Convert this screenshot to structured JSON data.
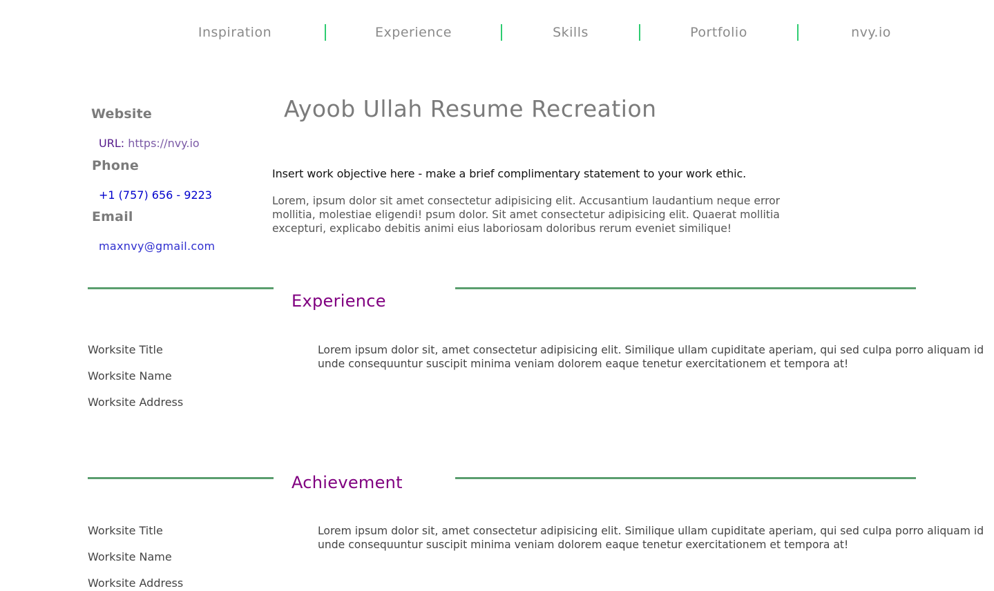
{
  "nav": {
    "items": [
      {
        "label": "Inspiration"
      },
      {
        "label": "Experience"
      },
      {
        "label": "Skills"
      },
      {
        "label": "Portfolio"
      },
      {
        "label": "nvy.io"
      }
    ]
  },
  "sidebar": {
    "website": {
      "heading": "Website",
      "label": "URL:",
      "value": "https://nvy.io"
    },
    "phone": {
      "heading": "Phone",
      "value": "+1 (757) 656 - 9223"
    },
    "email": {
      "heading": "Email",
      "value": "maxnvy@gmail.com"
    }
  },
  "main": {
    "title": "Ayoob Ullah Resume Recreation",
    "objective": "Insert work objective here - make a brief complimentary statement to your work ethic.",
    "intro": "Lorem, ipsum dolor sit amet consectetur adipisicing elit. Accusantium laudantium neque error mollitia, molestiae eligendi! psum dolor. Sit amet consectetur adipisicing elit. Quaerat mollitia excepturi, explicabo debitis animi eius laboriosam doloribus rerum eveniet similique!"
  },
  "sections": [
    {
      "title": "Experience",
      "worksite_title": "Worksite Title",
      "worksite_name": "Worksite Name",
      "worksite_address": "Worksite Address",
      "description": "Lorem ipsum dolor sit, amet consectetur adipisicing elit. Similique ullam cupiditate aperiam, qui sed culpa porro aliquam id unde consequuntur suscipit minima veniam dolorem eaque tenetur exercitationem et tempora at!"
    },
    {
      "title": "Achievement",
      "worksite_title": "Worksite Title",
      "worksite_name": "Worksite Name",
      "worksite_address": "Worksite Address",
      "description": "Lorem ipsum dolor sit, amet consectetur adipisicing elit. Similique ullam cupiditate aperiam, qui sed culpa porro aliquam id unde consequuntur suscipit minima veniam dolorem eaque tenetur exercitationem et tempora at!"
    }
  ],
  "colors": {
    "nav_separator": "#2ecc71",
    "section_rule": "#5a9e6e",
    "section_title": "#800080",
    "heading_gray": "#7b7b7b"
  }
}
